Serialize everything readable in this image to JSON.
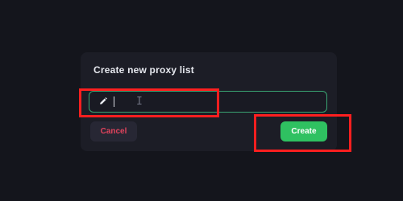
{
  "dialog": {
    "title": "Create new proxy list",
    "input": {
      "value": "",
      "placeholder": "",
      "icon": "pencil-icon",
      "ghost_text": "I",
      "accent_color": "#3aa573"
    },
    "buttons": {
      "cancel_label": "Cancel",
      "create_label": "Create",
      "cancel_color": "#e0435c",
      "create_color": "#2fc161"
    }
  },
  "annotations": {
    "highlight_color": "#ff1f1f"
  }
}
